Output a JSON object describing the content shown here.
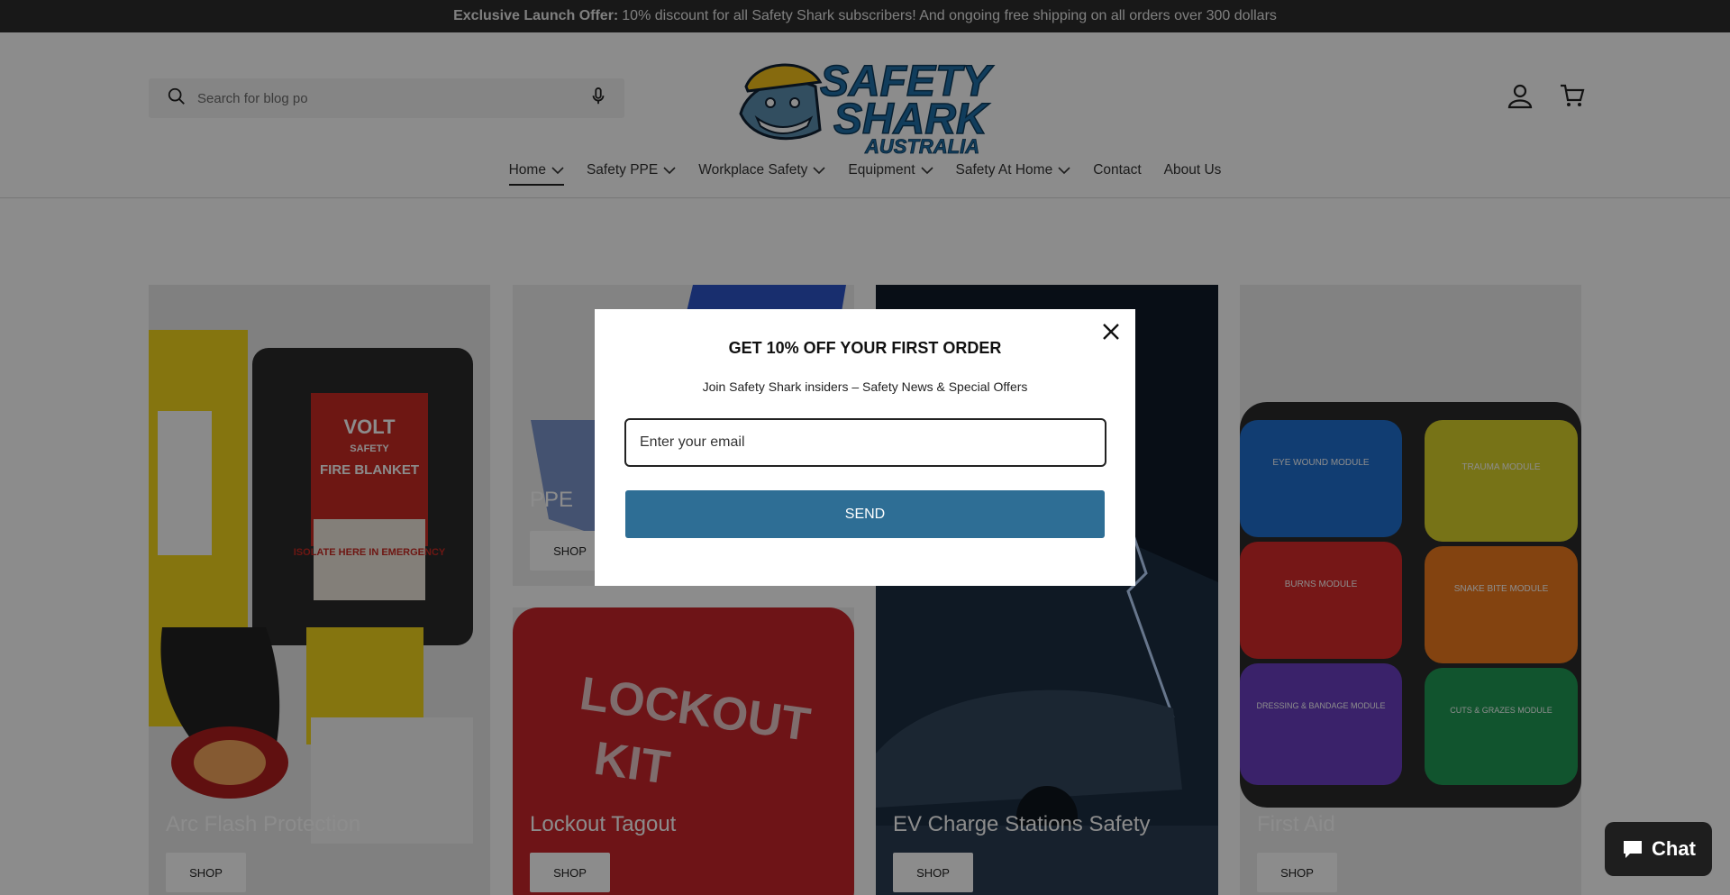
{
  "announcement": {
    "bold": "Exclusive Launch Offer:",
    "text": "10% discount for all Safety Shark subscribers! And ongoing free shipping on all orders over 300 dollars"
  },
  "search": {
    "placeholder": "Search for blog po"
  },
  "logo": {
    "line1": "SAFETY",
    "line2": "SHARK",
    "line3": "AUSTRALIA"
  },
  "nav": {
    "items": [
      {
        "label": "Home",
        "dropdown": true,
        "active": true
      },
      {
        "label": "Safety PPE",
        "dropdown": true
      },
      {
        "label": "Workplace Safety",
        "dropdown": true
      },
      {
        "label": "Equipment",
        "dropdown": true
      },
      {
        "label": "Safety At Home",
        "dropdown": true
      },
      {
        "label": "Contact",
        "dropdown": false
      },
      {
        "label": "About Us",
        "dropdown": false
      }
    ]
  },
  "collections": [
    {
      "title": "Arc Flash Protection",
      "shop": "SHOP",
      "image_text": [
        "VOLT",
        "SAFETY",
        "FIRE BLANKET",
        "ISOLATE HERE IN EMERGENCY"
      ]
    },
    {
      "title": "PPE",
      "shop": "SHOP"
    },
    {
      "title": "Lockout Tagout",
      "shop": "SHOP",
      "image_text": [
        "LOCKOUT",
        "KIT"
      ]
    },
    {
      "title": "EV Charge Stations Safety",
      "shop": "SHOP"
    },
    {
      "title": "First Aid",
      "shop": "SHOP",
      "image_text": [
        "EYE WOUND MODULE",
        "TRAUMA MODULE",
        "BURNS MODULE",
        "SNAKE BITE MODULE",
        "DRESSING & BANDAGE MODULE",
        "CUTS & GRAZES MODULE"
      ]
    }
  ],
  "popup": {
    "title": "GET 10% OFF YOUR FIRST ORDER",
    "subtitle": "Join Safety Shark insiders – Safety News & Special Offers",
    "email_placeholder": "Enter your email",
    "send_label": "SEND"
  },
  "chat": {
    "label": "Chat"
  },
  "colors": {
    "announcement_bg": "#2c2c2c",
    "brand_blue": "#2e6e95",
    "logo_blue": "#1f6fa8",
    "overlay": "rgba(0,0,0,0.45)"
  }
}
